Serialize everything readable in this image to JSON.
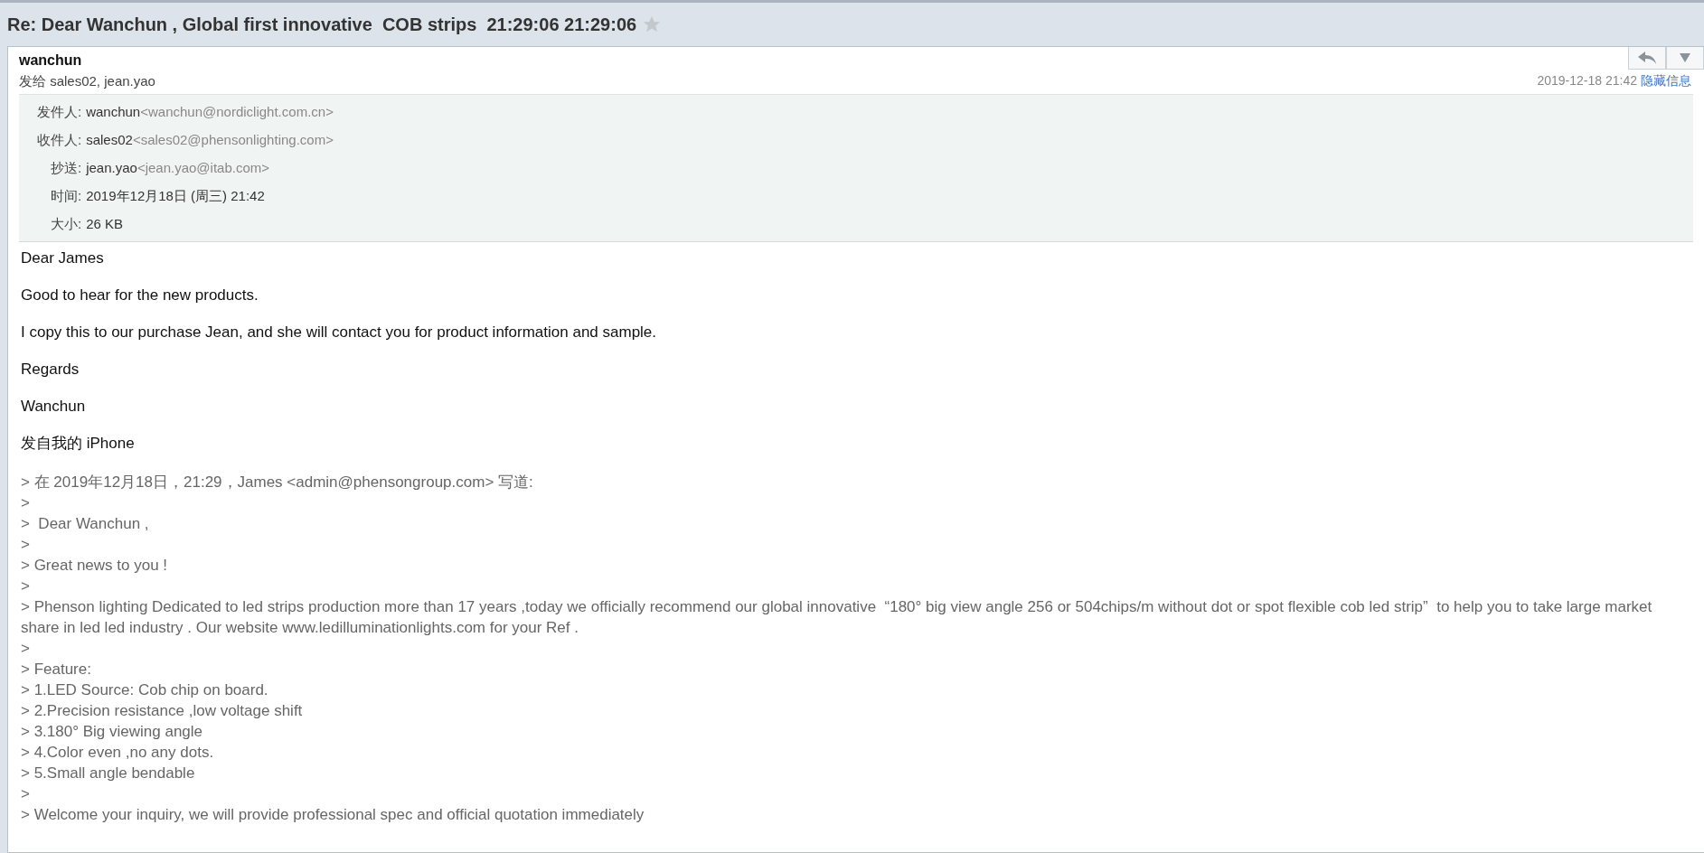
{
  "title": "Re: Dear Wanchun , Global first innovative  COB strips  21:29:06 21:29:06",
  "starred": false,
  "sender": "wanchun",
  "recipients_line": "发给 sales02, jean.yao",
  "date": "2019-12-18 21:42",
  "details_toggle": "隐藏信息",
  "details": [
    {
      "label": "发件人:",
      "name": "wanchun",
      "address": "<wanchun@nordiclight.com.cn>"
    },
    {
      "label": "收件人:",
      "name": "sales02",
      "address": "<sales02@phensonlighting.com>"
    },
    {
      "label": "抄送:",
      "name": "jean.yao",
      "address": "<jean.yao@itab.com>"
    },
    {
      "label": "时间:",
      "name": "2019年12月18日 (周三) 21:42"
    },
    {
      "label": "大小:",
      "name": "26 KB"
    }
  ],
  "body": [
    "Dear James",
    "Good to hear for the new products.",
    "I copy this to our purchase  Jean, and she will contact you for product information and sample.",
    "Regards",
    "Wanchun",
    "发自我的 iPhone"
  ],
  "quoted": [
    "> 在 2019年12月18日，21:29，James <admin@phensongroup.com> 写道:",
    ">",
    ">  Dear Wanchun ,",
    ">",
    "> Great news to you !",
    ">",
    "> Phenson lighting Dedicated to led strips production more than 17 years ,today we officially recommend our global innovative  “180° big view angle 256 or 504chips/m without dot or spot flexible cob led strip”  to help you to take large market share in led led industry . Our website www.ledilluminationlights.com for your Ref .",
    ">",
    "> Feature:",
    "> 1.LED Source: Cob chip on board.",
    "> 2.Precision resistance ,low voltage shift",
    "> 3.180° Big viewing angle",
    "> 4.Color even ,no any dots.",
    "> 5.Small angle bendable",
    ">",
    "> Welcome your inquiry, we will provide professional spec and official quotation immediately"
  ]
}
